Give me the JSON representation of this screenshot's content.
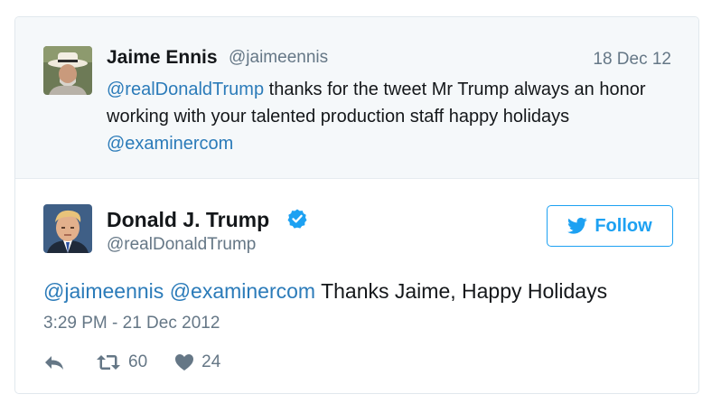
{
  "quoted_tweet": {
    "author_name": "Jaime Ennis",
    "author_handle": "@jaimeennis",
    "date": "18 Dec 12",
    "mention": "@realDonaldTrump",
    "text": " thanks for the tweet Mr Trump always an honor working with your talented production staff happy holidays ",
    "mention_end": "@examinercom",
    "avatar_icon": "avatar-photo-hat"
  },
  "main_tweet": {
    "author_name": "Donald J. Trump",
    "author_handle": "@realDonaldTrump",
    "verified_icon": "verified-badge-icon",
    "follow_label": "Follow",
    "mention_1": "@jaimeennis",
    "mention_2": "@examinercom",
    "text": " Thanks Jaime, Happy Holidays",
    "timestamp": "3:29 PM - 21 Dec 2012",
    "retweet_count": "60",
    "like_count": "24"
  },
  "colors": {
    "link": "#2b7bb9",
    "brand": "#1da1f2",
    "muted": "#657786",
    "quoted_bg": "#f5f8fa"
  }
}
